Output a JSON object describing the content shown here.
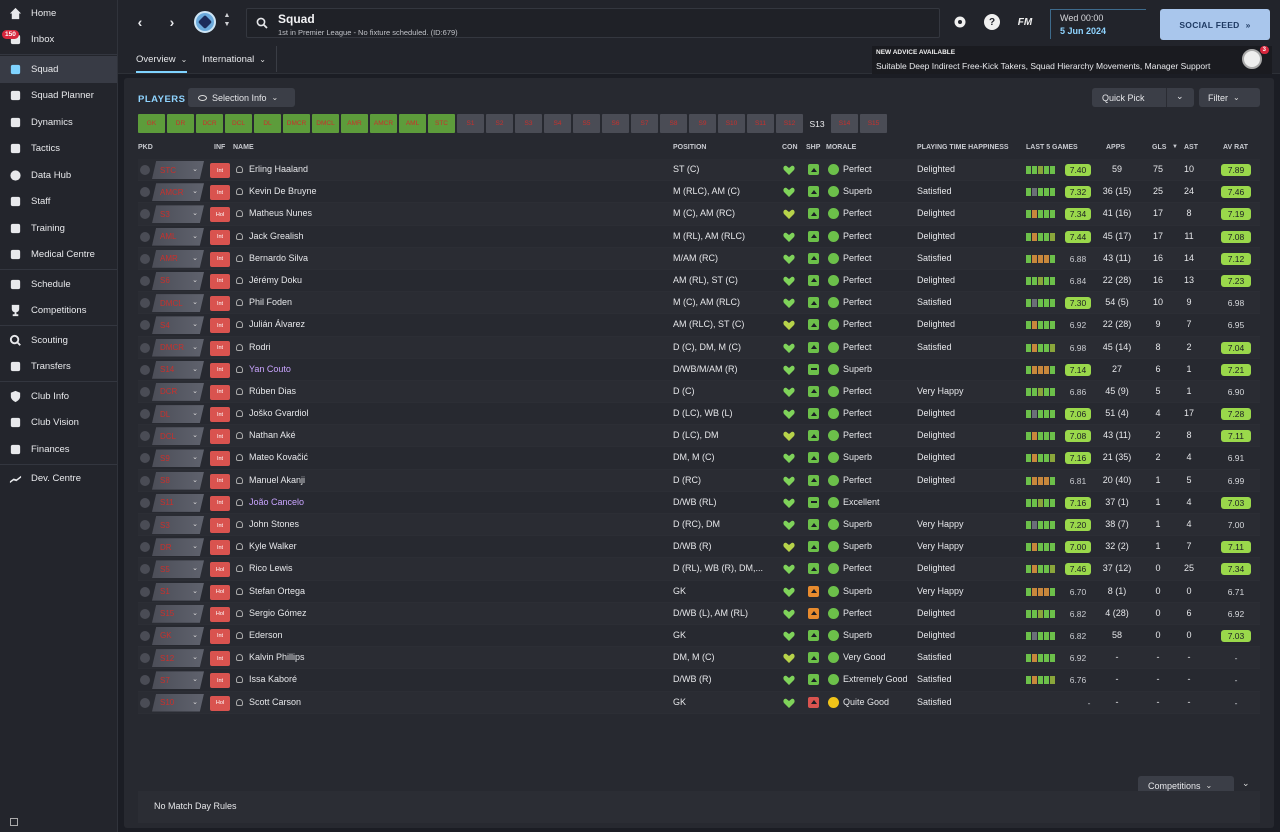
{
  "sidebar": {
    "inbox_count": "150",
    "items": [
      {
        "label": "Home",
        "icon": "home-icon"
      },
      {
        "label": "Inbox",
        "icon": "inbox-icon"
      },
      {
        "label": "Squad",
        "icon": "shirt-icon",
        "active": true
      },
      {
        "label": "Squad Planner",
        "icon": "clipboard-icon"
      },
      {
        "label": "Dynamics",
        "icon": "handshake-icon"
      },
      {
        "label": "Tactics",
        "icon": "board-icon"
      },
      {
        "label": "Data Hub",
        "icon": "globe-icon"
      },
      {
        "label": "Staff",
        "icon": "staff-icon"
      },
      {
        "label": "Training",
        "icon": "cone-icon"
      },
      {
        "label": "Medical Centre",
        "icon": "medkit-icon"
      },
      {
        "label": "Schedule",
        "icon": "calendar-icon"
      },
      {
        "label": "Competitions",
        "icon": "trophy-icon"
      },
      {
        "label": "Scouting",
        "icon": "magnifier-icon"
      },
      {
        "label": "Transfers",
        "icon": "transfer-icon"
      },
      {
        "label": "Club Info",
        "icon": "shield-icon"
      },
      {
        "label": "Club Vision",
        "icon": "briefcase-icon"
      },
      {
        "label": "Finances",
        "icon": "money-icon"
      },
      {
        "label": "Dev. Centre",
        "icon": "chart-icon"
      }
    ]
  },
  "header": {
    "title": "Squad",
    "subtitle": "1st in Premier League - No fixture scheduled. (ID:679)",
    "fm_label": "FM",
    "help_label": "?",
    "date_day": "Wed 00:00",
    "date_full": "5 Jun 2024",
    "social_feed": "SOCIAL FEED"
  },
  "tabs": {
    "overview": "Overview",
    "international": "International"
  },
  "advice": {
    "title": "NEW ADVICE AVAILABLE",
    "text": "Suitable Deep Indirect Free-Kick Takers, Squad Hierarchy Movements, Manager Support",
    "count": "3"
  },
  "toolbar": {
    "players_label": "PLAYERS",
    "selection_info": "Selection Info",
    "quick_pick": "Quick Pick",
    "filter": "Filter"
  },
  "chips": [
    {
      "label": "GK",
      "style": "green"
    },
    {
      "label": "DR",
      "style": "green"
    },
    {
      "label": "DCR",
      "style": "green"
    },
    {
      "label": "DCL",
      "style": "green"
    },
    {
      "label": "DL",
      "style": "green"
    },
    {
      "label": "DMCR",
      "style": "green"
    },
    {
      "label": "DMCL",
      "style": "green"
    },
    {
      "label": "AMR",
      "style": "green"
    },
    {
      "label": "AMCR",
      "style": "green"
    },
    {
      "label": "AML",
      "style": "green"
    },
    {
      "label": "STC",
      "style": "green"
    },
    {
      "label": "S1",
      "style": "gray"
    },
    {
      "label": "S2",
      "style": "gray"
    },
    {
      "label": "S3",
      "style": "gray"
    },
    {
      "label": "S4",
      "style": "gray"
    },
    {
      "label": "S5",
      "style": "gray"
    },
    {
      "label": "S6",
      "style": "gray"
    },
    {
      "label": "S7",
      "style": "gray"
    },
    {
      "label": "S8",
      "style": "gray"
    },
    {
      "label": "S9",
      "style": "gray"
    },
    {
      "label": "S10",
      "style": "gray"
    },
    {
      "label": "S11",
      "style": "gray"
    },
    {
      "label": "S12",
      "style": "gray"
    },
    {
      "label": "S13",
      "style": "none"
    },
    {
      "label": "S14",
      "style": "gray"
    },
    {
      "label": "S15",
      "style": "gray"
    }
  ],
  "columns": {
    "pkd": "PKD",
    "inf": "INF",
    "name": "NAME",
    "position": "POSITION",
    "con": "CON",
    "shp": "SHP",
    "morale": "MORALE",
    "pth": "PLAYING TIME HAPPINESS",
    "last5": "LAST 5 GAMES",
    "apps": "APPS",
    "gls": "GLS",
    "ast": "AST",
    "avrat": "AV RAT"
  },
  "players": [
    {
      "pkd": "STC",
      "inf": "Int",
      "name": "Erling Haaland",
      "position": "ST (C)",
      "morale": "Perfect",
      "pth": "Delighted",
      "form": "7.40",
      "apps": "59",
      "gls": "75",
      "ast": "10",
      "avrat": "7.89",
      "form_hi": true,
      "avrat_hi": true
    },
    {
      "pkd": "AMCR",
      "inf": "Int",
      "name": "Kevin De Bruyne",
      "position": "M (RLC), AM (C)",
      "morale": "Superb",
      "pth": "Satisfied",
      "form": "7.32",
      "apps": "36 (15)",
      "gls": "25",
      "ast": "24",
      "avrat": "7.46",
      "form_hi": true,
      "avrat_hi": true
    },
    {
      "pkd": "S3",
      "inf": "Hol",
      "name": "Matheus Nunes",
      "position": "M (C), AM (RC)",
      "morale": "Perfect",
      "pth": "Delighted",
      "form": "7.34",
      "apps": "41 (16)",
      "gls": "17",
      "ast": "8",
      "avrat": "7.19",
      "form_hi": true,
      "avrat_hi": true
    },
    {
      "pkd": "AML",
      "inf": "Int",
      "name": "Jack Grealish",
      "position": "M (RL), AM (RLC)",
      "morale": "Perfect",
      "pth": "Delighted",
      "form": "7.44",
      "apps": "45 (17)",
      "gls": "17",
      "ast": "11",
      "avrat": "7.08",
      "form_hi": true,
      "avrat_hi": true
    },
    {
      "pkd": "AMR",
      "inf": "Int",
      "name": "Bernardo Silva",
      "position": "M/AM (RC)",
      "morale": "Perfect",
      "pth": "Satisfied",
      "form": "6.88",
      "apps": "43 (11)",
      "gls": "16",
      "ast": "14",
      "avrat": "7.12",
      "form_hi": false,
      "avrat_hi": true
    },
    {
      "pkd": "S6",
      "inf": "Int",
      "name": "Jérémy Doku",
      "position": "AM (RL), ST (C)",
      "morale": "Perfect",
      "pth": "Delighted",
      "form": "6.84",
      "apps": "22 (28)",
      "gls": "16",
      "ast": "13",
      "avrat": "7.23",
      "form_hi": false,
      "avrat_hi": true
    },
    {
      "pkd": "DMCL",
      "inf": "Int",
      "name": "Phil Foden",
      "position": "M (C), AM (RLC)",
      "morale": "Perfect",
      "pth": "Satisfied",
      "form": "7.30",
      "apps": "54 (5)",
      "gls": "10",
      "ast": "9",
      "avrat": "6.98",
      "form_hi": true,
      "avrat_hi": false
    },
    {
      "pkd": "S4",
      "inf": "Int",
      "name": "Julián Álvarez",
      "position": "AM (RLC), ST (C)",
      "morale": "Perfect",
      "pth": "Delighted",
      "form": "6.92",
      "apps": "22 (28)",
      "gls": "9",
      "ast": "7",
      "avrat": "6.95",
      "form_hi": false,
      "avrat_hi": false
    },
    {
      "pkd": "DMCR",
      "inf": "Int",
      "name": "Rodri",
      "position": "D (C), DM, M (C)",
      "morale": "Perfect",
      "pth": "Satisfied",
      "form": "6.98",
      "apps": "45 (14)",
      "gls": "8",
      "ast": "2",
      "avrat": "7.04",
      "form_hi": false,
      "avrat_hi": true
    },
    {
      "pkd": "S14",
      "inf": "Int",
      "name": "Yan Couto",
      "position": "D/WB/M/AM (R)",
      "morale": "Superb",
      "pth": "",
      "form": "7.14",
      "apps": "27",
      "gls": "6",
      "ast": "1",
      "avrat": "7.21",
      "form_hi": true,
      "avrat_hi": true,
      "purple": true
    },
    {
      "pkd": "DCR",
      "inf": "Int",
      "name": "Rúben Dias",
      "position": "D (C)",
      "morale": "Perfect",
      "pth": "Very Happy",
      "form": "6.86",
      "apps": "45 (9)",
      "gls": "5",
      "ast": "1",
      "avrat": "6.90",
      "form_hi": false,
      "avrat_hi": false
    },
    {
      "pkd": "DL",
      "inf": "Int",
      "name": "Joško Gvardiol",
      "position": "D (LC), WB (L)",
      "morale": "Perfect",
      "pth": "Delighted",
      "form": "7.06",
      "apps": "51 (4)",
      "gls": "4",
      "ast": "17",
      "avrat": "7.28",
      "form_hi": true,
      "avrat_hi": true
    },
    {
      "pkd": "DCL",
      "inf": "Int",
      "name": "Nathan Aké",
      "position": "D (LC), DM",
      "morale": "Perfect",
      "pth": "Delighted",
      "form": "7.08",
      "apps": "43 (11)",
      "gls": "2",
      "ast": "8",
      "avrat": "7.11",
      "form_hi": true,
      "avrat_hi": true
    },
    {
      "pkd": "S9",
      "inf": "Int",
      "name": "Mateo Kovačić",
      "position": "DM, M (C)",
      "morale": "Superb",
      "pth": "Delighted",
      "form": "7.16",
      "apps": "21 (35)",
      "gls": "2",
      "ast": "4",
      "avrat": "6.91",
      "form_hi": true,
      "avrat_hi": false
    },
    {
      "pkd": "S8",
      "inf": "Int",
      "name": "Manuel Akanji",
      "position": "D (RC)",
      "morale": "Perfect",
      "pth": "Delighted",
      "form": "6.81",
      "apps": "20 (40)",
      "gls": "1",
      "ast": "5",
      "avrat": "6.99",
      "form_hi": false,
      "avrat_hi": false
    },
    {
      "pkd": "S11",
      "inf": "Int",
      "name": "João Cancelo",
      "position": "D/WB (RL)",
      "morale": "Excellent",
      "pth": "",
      "form": "7.16",
      "apps": "37 (1)",
      "gls": "1",
      "ast": "4",
      "avrat": "7.03",
      "form_hi": true,
      "avrat_hi": true,
      "purple": true
    },
    {
      "pkd": "S3",
      "inf": "Int",
      "name": "John Stones",
      "position": "D (RC), DM",
      "morale": "Superb",
      "pth": "Very Happy",
      "form": "7.20",
      "apps": "38 (7)",
      "gls": "1",
      "ast": "4",
      "avrat": "7.00",
      "form_hi": true,
      "avrat_hi": false
    },
    {
      "pkd": "DR",
      "inf": "Int",
      "name": "Kyle Walker",
      "position": "D/WB (R)",
      "morale": "Superb",
      "pth": "Very Happy",
      "form": "7.00",
      "apps": "32 (2)",
      "gls": "1",
      "ast": "7",
      "avrat": "7.11",
      "form_hi": true,
      "avrat_hi": true
    },
    {
      "pkd": "S5",
      "inf": "Hol",
      "name": "Rico Lewis",
      "position": "D (RL), WB (R), DM,...",
      "morale": "Perfect",
      "pth": "Delighted",
      "form": "7.46",
      "apps": "37 (12)",
      "gls": "0",
      "ast": "25",
      "avrat": "7.34",
      "form_hi": true,
      "avrat_hi": true
    },
    {
      "pkd": "S1",
      "inf": "Hol",
      "name": "Stefan Ortega",
      "position": "GK",
      "morale": "Superb",
      "pth": "Very Happy",
      "form": "6.70",
      "apps": "8 (1)",
      "gls": "0",
      "ast": "0",
      "avrat": "6.71",
      "form_hi": false,
      "avrat_hi": false
    },
    {
      "pkd": "S15",
      "inf": "Hol",
      "name": "Sergio Gómez",
      "position": "D/WB (L), AM (RL)",
      "morale": "Perfect",
      "pth": "Delighted",
      "form": "6.82",
      "apps": "4 (28)",
      "gls": "0",
      "ast": "6",
      "avrat": "6.92",
      "form_hi": false,
      "avrat_hi": false
    },
    {
      "pkd": "GK",
      "inf": "Int",
      "name": "Ederson",
      "position": "GK",
      "morale": "Superb",
      "pth": "Delighted",
      "form": "6.82",
      "apps": "58",
      "gls": "0",
      "ast": "0",
      "avrat": "7.03",
      "form_hi": false,
      "avrat_hi": true
    },
    {
      "pkd": "S12",
      "inf": "Int",
      "name": "Kalvin Phillips",
      "position": "DM, M (C)",
      "morale": "Very Good",
      "pth": "Satisfied",
      "form": "6.92",
      "apps": "-",
      "gls": "-",
      "ast": "-",
      "avrat": "-",
      "form_hi": false,
      "avrat_hi": false
    },
    {
      "pkd": "S7",
      "inf": "Int",
      "name": "Issa Kaboré",
      "position": "D/WB (R)",
      "morale": "Extremely Good",
      "pth": "Satisfied",
      "form": "6.76",
      "apps": "-",
      "gls": "-",
      "ast": "-",
      "avrat": "-",
      "form_hi": false,
      "avrat_hi": false
    },
    {
      "pkd": "S10",
      "inf": "Hol",
      "name": "Scott Carson",
      "position": "GK",
      "morale": "Quite Good",
      "pth": "Satisfied",
      "form": "-",
      "apps": "-",
      "gls": "-",
      "ast": "-",
      "avrat": "-",
      "form_hi": false,
      "avrat_hi": false
    }
  ],
  "footer": {
    "competitions": "Competitions",
    "match_day_rules": "No Match Day Rules"
  },
  "colors": {
    "accent": "#7fd3ff",
    "rating_good": "#9ad84b",
    "chip_green": "#5d9c3b",
    "badge_red": "#d9534f"
  }
}
